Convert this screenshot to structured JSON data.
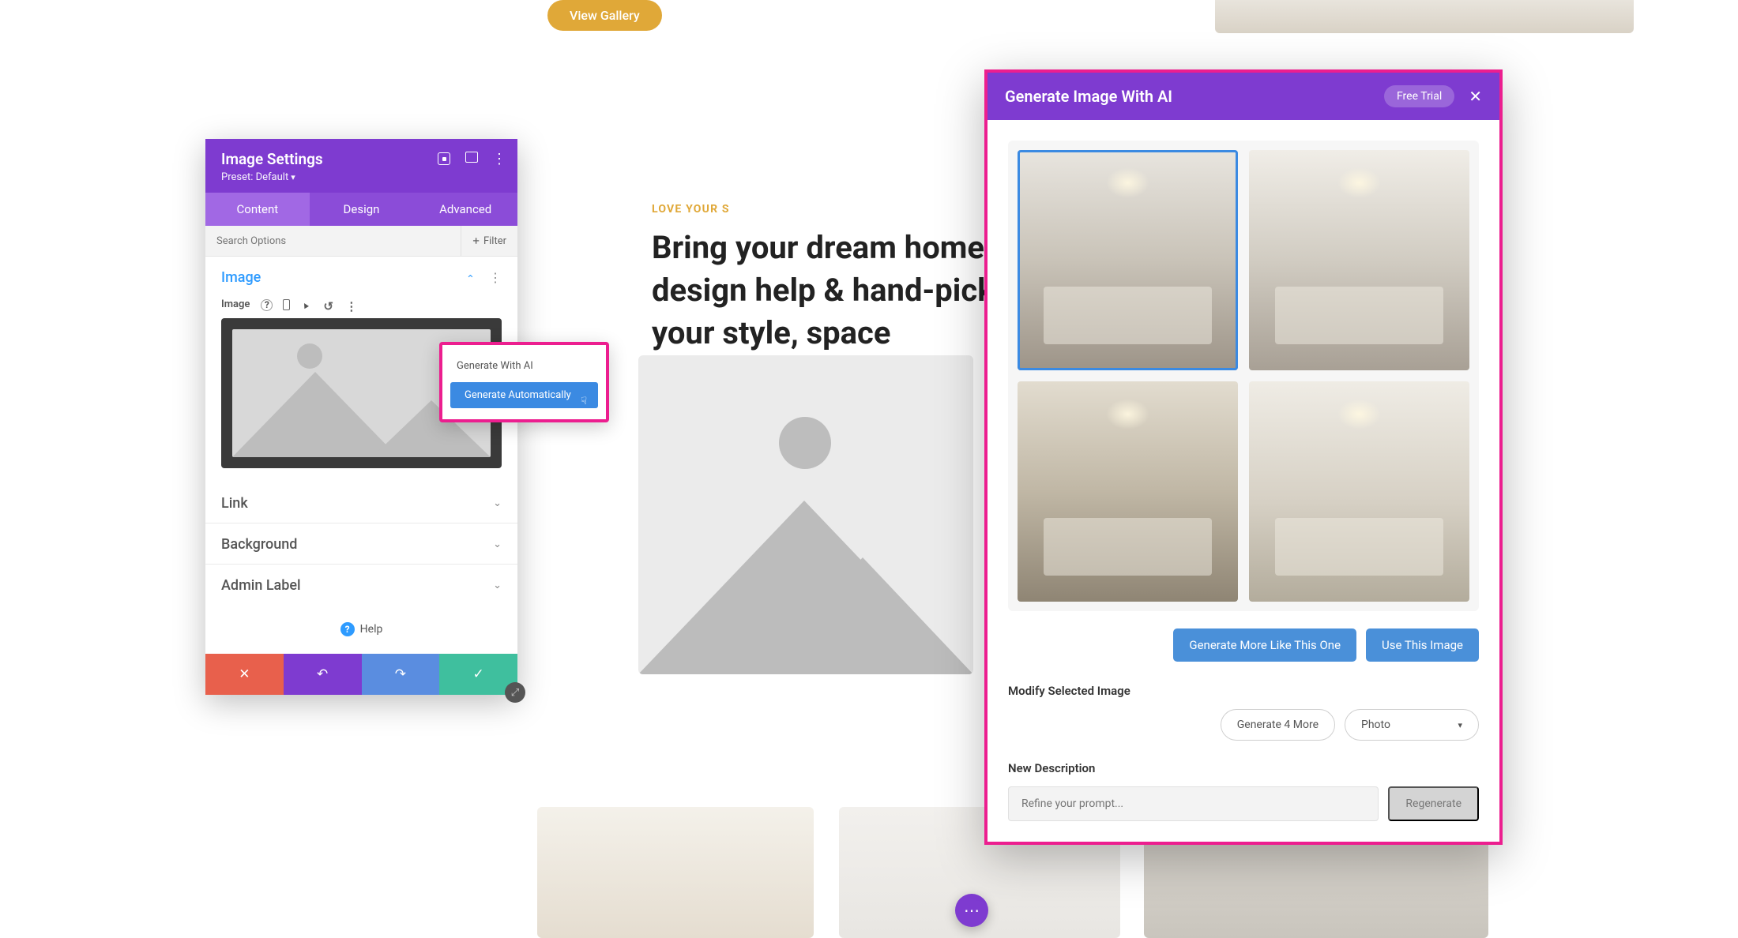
{
  "topButton": {
    "viewGallery": "View Gallery"
  },
  "settings": {
    "title": "Image Settings",
    "preset": "Preset: Default",
    "tabs": {
      "content": "Content",
      "design": "Design",
      "advanced": "Advanced"
    },
    "searchPlaceholder": "Search Options",
    "filter": "Filter",
    "sections": {
      "image": "Image",
      "imageLabel": "Image",
      "link": "Link",
      "background": "Background",
      "adminLabel": "Admin Label"
    },
    "aiMenu": {
      "generateWithAI": "Generate With AI",
      "generateAuto": "Generate Automatically"
    },
    "help": "Help"
  },
  "background": {
    "tagline": "LOVE YOUR S",
    "headline": "Bring your dream home to",
    "headline2": "design help & hand-picke",
    "headline3": "your style, space"
  },
  "modal": {
    "title": "Generate Image With AI",
    "trial": "Free Trial",
    "generateMore": "Generate More Like This One",
    "useImage": "Use This Image",
    "modifyHeading": "Modify Selected Image",
    "generate4": "Generate 4 More",
    "styleSelect": "Photo",
    "newDesc": "New Description",
    "promptPlaceholder": "Refine your prompt...",
    "regenerate": "Regenerate"
  }
}
